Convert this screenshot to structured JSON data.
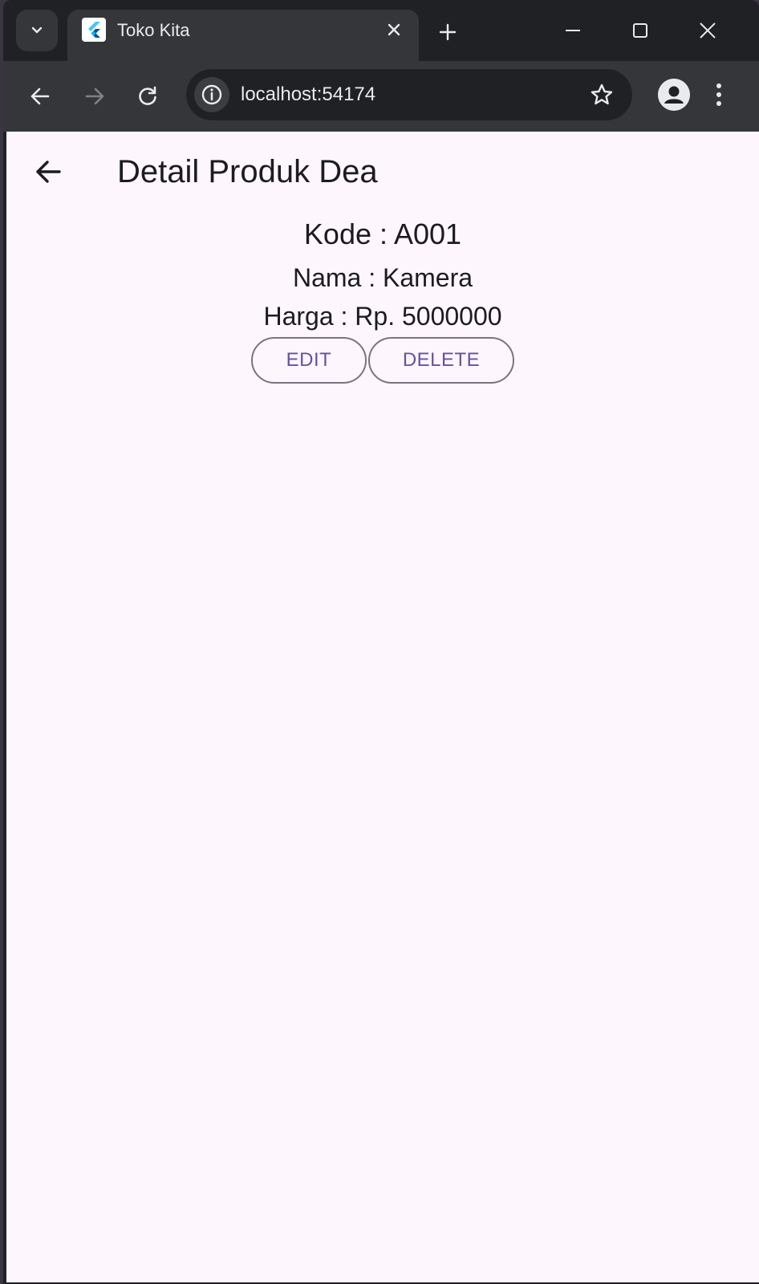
{
  "browser": {
    "tab": {
      "title": "Toko Kita",
      "favicon": "flutter-icon"
    },
    "address_bar": {
      "url": "localhost:54174"
    }
  },
  "app": {
    "appbar": {
      "title": "Detail Produk Dea"
    },
    "product": {
      "kode": "Kode : A001",
      "nama": "Nama : Kamera",
      "harga": "Harga : Rp. 5000000"
    },
    "actions": {
      "edit_label": "EDIT",
      "delete_label": "DELETE"
    }
  },
  "colors": {
    "page_background": "#fdf7fd",
    "button_text": "#6750a4",
    "button_border": "#79747e",
    "browser_frame": "#202124",
    "browser_toolbar": "#35363a"
  }
}
